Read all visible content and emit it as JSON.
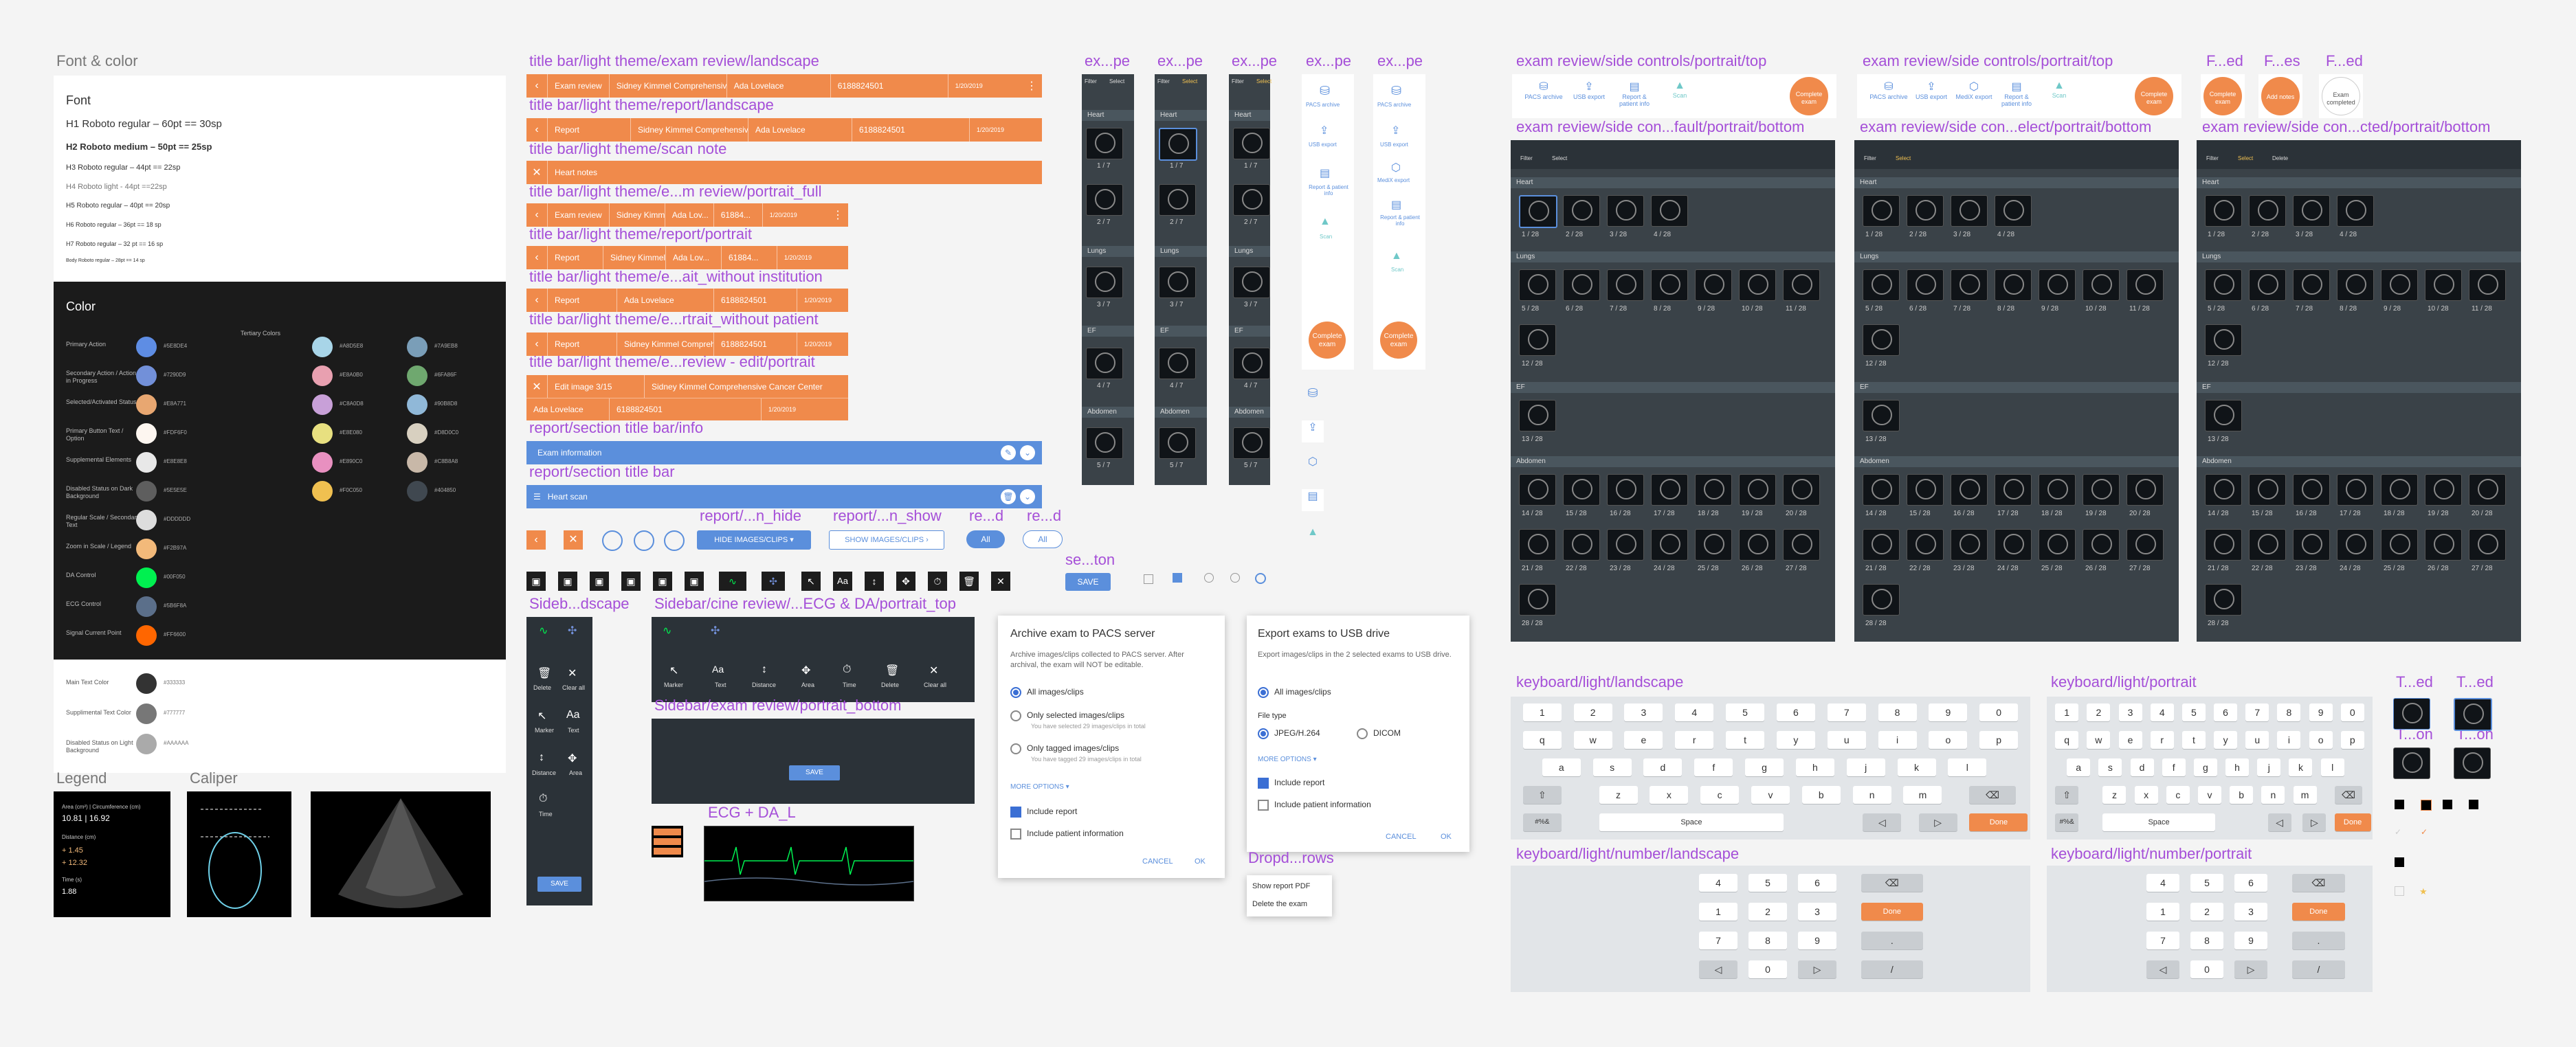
{
  "labels": {
    "font_color": "Font & color",
    "legend": "Legend",
    "caliper": "Caliper",
    "tb_exam_land": "title bar/light theme/exam review/landscape",
    "tb_report_land": "title bar/light theme/report/landscape",
    "tb_scan_note": "title bar/light theme/scan note",
    "tb_portrait_full": "title bar/light theme/e...m review/portrait_full",
    "tb_report_portrait": "title bar/light theme/report/portrait",
    "tb_wo_institution": "title bar/light theme/e...ait_without institution",
    "tb_wo_patient": "title bar/light theme/e...rtrait_without patient",
    "tb_edit_portrait": "title bar/light theme/e...review - edit/portrait",
    "rs_title_info": "report/section title bar/info",
    "rs_title": "report/section title bar",
    "r_on_hide": "report/...n_hide",
    "r_n_show": "report/...n_show",
    "re_d1": "re...d",
    "re_d2": "re...d",
    "se_ton": "se...ton",
    "sideb_landscape": "Sideb...dscape",
    "sidebar_cine": "Sidebar/cine review/...ECG & DA/portrait_top",
    "sidebar_exam_bottom": "Sidebar/exam review/portrait_bottom",
    "ecg_dal": "ECG + DA_L",
    "dropd_rows": "Dropd...rows",
    "ex_pe": [
      "ex...pe",
      "ex...pe",
      "ex...pe",
      "ex...pe",
      "ex...pe"
    ],
    "esc_portrait_top_1": "exam review/side controls/portrait/top",
    "esc_portrait_top_2": "exam review/side controls/portrait/top",
    "f_ed": "F...ed",
    "f_es": "F...es",
    "f_ed2": "F...ed",
    "esc_default_bottom": "exam review/side con...fault/portrait/bottom",
    "esc_select_bottom": "exam review/side con...elect/portrait/bottom",
    "esc_selected_bottom": "exam review/side con...cted/portrait/bottom",
    "kb_land": "keyboard/light/landscape",
    "kb_port": "keyboard/light/portrait",
    "kb_num_land": "keyboard/light/number/landscape",
    "kb_num_port": "keyboard/light/number/portrait",
    "t_ed1": "T...ed",
    "t_ed2": "T...ed",
    "t_on1": "T...on",
    "t_on2": "T...on"
  },
  "font": {
    "title": "Font",
    "h1": "H1 Roboto regular – 60pt == 30sp",
    "h2": "H2 Roboto medium – 50pt == 25sp",
    "h3": "H3 Roboto regular – 44pt == 22sp",
    "h4": "H4 Roboto light - 44pt ==22sp",
    "h5": "H5 Roboto regular – 40pt == 20sp",
    "h6": "H6 Roboto regular – 36pt == 18 sp",
    "h7": "H7 Roboto regular – 32 pt == 16 sp",
    "body": "Body Roboto regular – 28pt == 14 sp"
  },
  "colors": {
    "title": "Color",
    "tertiary": "Tertiary Colors",
    "items": [
      {
        "name": "Primary Action",
        "hex": "#5E8DE4",
        "c": "#5e8de4"
      },
      {
        "name": "Secondary Action / Action in Progress",
        "hex": "#7290D9",
        "c": "#7290d9"
      },
      {
        "name": "Selected/Activated Status",
        "hex": "#E8A771",
        "c": "#e8a771"
      },
      {
        "name": "Primary Button Text / Option",
        "hex": "#FDF6F0",
        "c": "#fdf6f0"
      },
      {
        "name": "Supplemental Elements",
        "hex": "#E8E8E8",
        "c": "#e8e8e8"
      },
      {
        "name": "Disabled Status on Dark Background",
        "hex": "#5E5E5E",
        "c": "#5e5e5e"
      },
      {
        "name": "Regular Scale / Secondary Text",
        "hex": "#DDDDDD",
        "c": "#dddddd"
      },
      {
        "name": "Zoom in Scale / Legend",
        "hex": "#F2B97A",
        "c": "#f2b97a"
      },
      {
        "name": "DA Control",
        "hex": "#00F050",
        "c": "#00f050"
      },
      {
        "name": "ECG Control",
        "hex": "#5B6F8A",
        "c": "#5b6f8a"
      },
      {
        "name": "Signal Current Point",
        "hex": "#FF6600",
        "c": "#ff6600"
      }
    ],
    "tertiary_items": [
      {
        "hex": "#A8D5E8",
        "c": "#a8d5e8"
      },
      {
        "hex": "#7A9EB8",
        "c": "#7a9eb8"
      },
      {
        "hex": "#E8A0B0",
        "c": "#e8a0b0"
      },
      {
        "hex": "#6FA86F",
        "c": "#6fa86f"
      },
      {
        "hex": "#C8A0D8",
        "c": "#c8a0d8"
      },
      {
        "hex": "#90B8D8",
        "c": "#90b8d8"
      },
      {
        "hex": "#E8E080",
        "c": "#e8e080"
      },
      {
        "hex": "#D8D0C0",
        "c": "#d8d0c0"
      },
      {
        "hex": "#E890C0",
        "c": "#e890c0"
      },
      {
        "hex": "#C8B8A8",
        "c": "#c8b8a8"
      },
      {
        "hex": "#F0C050",
        "c": "#f0c050"
      },
      {
        "hex": "#404850",
        "c": "#404850"
      }
    ],
    "text_items": [
      {
        "name": "Main Text Color",
        "hex": "#333333",
        "c": "#333333"
      },
      {
        "name": "Supplimental Text Color",
        "hex": "#777777",
        "c": "#777777"
      },
      {
        "name": "Disabled Status on Light Background",
        "hex": "#AAAAAA",
        "c": "#aaaaaa"
      }
    ]
  },
  "legend": {
    "area": "Area (cm²) | Circumference (cm)",
    "v1": "10.81 | 16.92",
    "distance": "Distance (cm)",
    "d1": "+ 1.45",
    "d2": "+ 12.32",
    "time": "Time (s)",
    "t1": "1.88"
  },
  "bars": {
    "exam_review": "Exam review",
    "institution": "Sidney Kimmel Comprehensive Cancer Center",
    "patient": "Ada Lovelace",
    "id": "6188824501",
    "date": "1/20/2019",
    "time": "10:09:11 am",
    "report": "Report",
    "heart_notes": "Heart notes",
    "institution_short": "Sidney Kimmel...",
    "patient_short": "Ada Lov...",
    "id_short": "61884...",
    "institution_2": "Sidney Kimmel Comprehensive C...",
    "edit_image": "Edit image 3/15",
    "exam_information": "Exam information",
    "heart_scan": "Heart scan"
  },
  "controls": {
    "hide": "HIDE IMAGES/CLIPS",
    "show": "SHOW IMAGES/CLIPS",
    "all1": "All",
    "all2": "All",
    "save": "SAVE",
    "aa": "Aa"
  },
  "sidebar": {
    "delete": "Delete",
    "clear_all": "Clear all",
    "marker": "Marker",
    "text": "Text",
    "distance": "Distance",
    "area": "Area",
    "time": "Time",
    "save": "SAVE"
  },
  "pacs": {
    "title": "Archive exam to PACS server",
    "desc": "Archive images/clips collected to PACS server. After archival, the exam will NOT be editable.",
    "opt_all": "All images/clips",
    "opt_selected": "Only selected images/clips",
    "opt_selected_sub": "You have selected 29 images/clips in total",
    "opt_tagged": "Only tagged images/clips",
    "opt_tagged_sub": "You have tagged 29 images/clips in total",
    "more": "MORE OPTIONS",
    "report": "Include report",
    "patient_info": "Include patient information",
    "cancel": "CANCEL",
    "ok": "OK"
  },
  "usb": {
    "title": "Export exams to USB drive",
    "desc": "Export images/clips in the 2 selected exams to USB drive.",
    "opt_all": "All images/clips",
    "file_type": "File type",
    "jpeg": "JPEG/H.264",
    "dicom": "DICOM",
    "more": "MORE OPTIONS",
    "report": "Include report",
    "patient_info": "Include patient information",
    "cancel": "CANCEL",
    "ok": "OK"
  },
  "dropdown": {
    "show_pdf": "Show report PDF",
    "delete_exam": "Delete the exam"
  },
  "strip": {
    "filter": "Filter",
    "select": "Select",
    "delete": "Delete",
    "heart": "Heart",
    "lungs": "Lungs",
    "ef": "EF",
    "abdomen": "Abdomen",
    "n17": "1 / 7",
    "n27": "2 / 7",
    "n37": "3 / 7",
    "n47": "4 / 7",
    "n57": "5 / 7"
  },
  "sidecol": {
    "pacs_archive": "PACS archive",
    "usb_export": "USB export",
    "report_info": "Report & patient info",
    "scan": "Scan",
    "complete": "Complete exam",
    "medi_export": "MediX export"
  },
  "grid": {
    "heart": "Heart",
    "lungs": "Lungs",
    "ef": "EF",
    "abdomen": "Abdomen",
    "filter": "Filter",
    "select": "Select",
    "delete": "Delete",
    "heart_nums": [
      "1 / 28",
      "2 / 28",
      "3 / 28",
      "4 / 28"
    ],
    "lung_nums": [
      "5 / 28",
      "6 / 28",
      "7 / 28",
      "8 / 28",
      "9 / 28",
      "10 / 28",
      "11 / 28",
      "12 / 28"
    ],
    "ef_nums": [
      "13 / 28"
    ],
    "abd_nums": [
      "14 / 28",
      "15 / 28",
      "16 / 28",
      "17 / 28",
      "18 / 28",
      "19 / 28",
      "20 / 28",
      "21 / 28",
      "22 / 28",
      "23 / 28",
      "24 / 28",
      "25 / 28",
      "26 / 28",
      "27 / 28",
      "28 / 28"
    ]
  },
  "topctl": {
    "pacs": "PACS archive",
    "usb": "USB export",
    "report": "Report & patient info",
    "scan": "Scan",
    "complete": "Complete exam",
    "medi": "MediX export",
    "add_notes": "Add notes",
    "exam_completed": "Exam completed"
  },
  "keyboard": {
    "row1": [
      "1",
      "2",
      "3",
      "4",
      "5",
      "6",
      "7",
      "8",
      "9",
      "0"
    ],
    "row2": [
      "q",
      "w",
      "e",
      "r",
      "t",
      "y",
      "u",
      "i",
      "o",
      "p"
    ],
    "row3": [
      "a",
      "s",
      "d",
      "f",
      "g",
      "h",
      "j",
      "k",
      "l"
    ],
    "row4": [
      "z",
      "x",
      "c",
      "v",
      "b",
      "n",
      "m"
    ],
    "sym": "#%&",
    "space": "Space",
    "done": "Done",
    "numpad": [
      "4",
      "5",
      "6",
      "1",
      "2",
      "3",
      "7",
      "8",
      "9",
      "4",
      "5",
      "6",
      "1",
      "2",
      "3",
      "7",
      "8",
      "9",
      "0",
      "/",
      "."
    ]
  }
}
